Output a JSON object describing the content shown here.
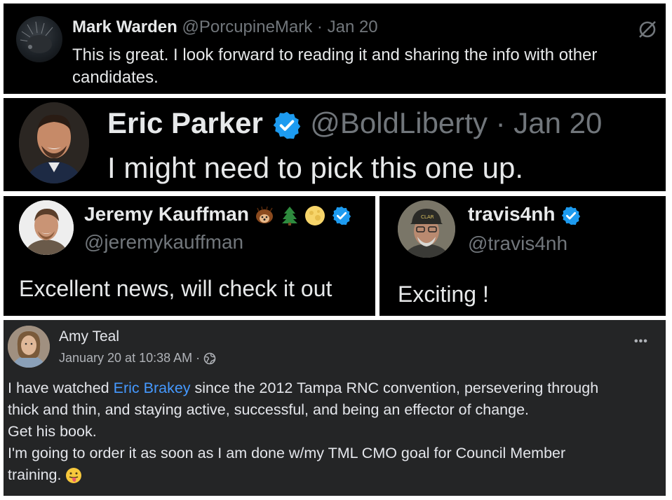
{
  "post1": {
    "author": "Mark Warden",
    "handle": "@PorcupineMark",
    "date_sep": "·",
    "date": "Jan 20",
    "text_line1": "This is great. I look forward to reading it and sharing the info with other",
    "text_line2": "candidates.",
    "icon": "grok-slash-icon"
  },
  "post2": {
    "author": "Eric Parker",
    "handle": "@BoldLiberty",
    "date_sep": "·",
    "date": "Jan 20",
    "text": "I might need to pick this one up.",
    "verified": true,
    "badge_color": "#1d9bf0"
  },
  "post3": {
    "author": "Jeremy Kauffman",
    "emojis": [
      "hedgehog",
      "evergreen-tree",
      "full-moon"
    ],
    "handle": "@jeremykauffman",
    "text": "Excellent news, will check it out",
    "verified": true
  },
  "post4": {
    "author": "travis4nh",
    "handle": "@travis4nh",
    "text": "Exciting !",
    "verified": true
  },
  "post5": {
    "author": "Amy Teal",
    "timestamp": "January 20 at 10:38 AM",
    "meta_sep": "·",
    "more": "•••",
    "body_pre_link": "I have watched ",
    "link": "Eric Brakey",
    "body_post_link": " since the 2012 Tampa RNC convention, persevering through",
    "line2": "thick and thin, and staying active, successful, and being an effector of change.",
    "line3": "Get his book.",
    "line4": "I'm going to order it as soon as I am done w/my TML CMO goal for Council Member",
    "line5": "training.",
    "link_color": "#4599ff"
  }
}
